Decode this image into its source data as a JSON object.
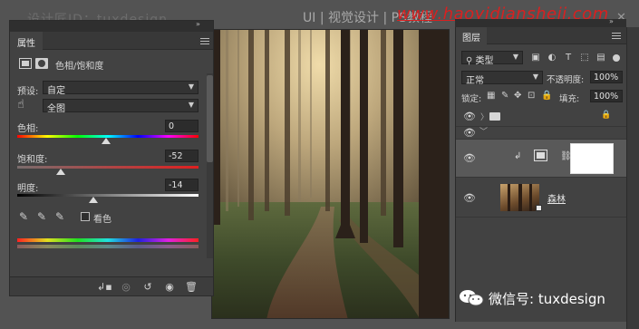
{
  "watermarks": {
    "top_left": "设计匠ID：tuxdesign",
    "top_center": "UI | 视觉设计 | PS教程",
    "top_red": "www.haoyidiansheji.com",
    "bottom_right": "微信号: tuxdesign"
  },
  "properties": {
    "tab_label": "属性",
    "adjustment_title": "色相/饱和度",
    "preset_label": "预设:",
    "preset_value": "自定",
    "channel_value": "全图",
    "hue_label": "色相:",
    "hue_value": "0",
    "saturation_label": "饱和度:",
    "saturation_value": "-52",
    "lightness_label": "明度:",
    "lightness_value": "-14",
    "colorize_label": "看色",
    "slider_levels": {
      "hue_fraction": 0.5,
      "saturation_fraction": 0.24,
      "lightness_fraction": 0.43
    }
  },
  "layers": {
    "tab_label": "图层",
    "filter_type": "类型",
    "blend_mode": "正常",
    "opacity_label": "不透明度:",
    "opacity_value": "100%",
    "lock_label": "锁定:",
    "fill_label": "填充:",
    "fill_value": "100%",
    "layer_names": {
      "forest": "森林"
    }
  },
  "colors": {
    "panel_bg": "#424242",
    "workspace_bg": "#535353",
    "selected_row": "#595959",
    "watermark_red": "#d92020"
  }
}
